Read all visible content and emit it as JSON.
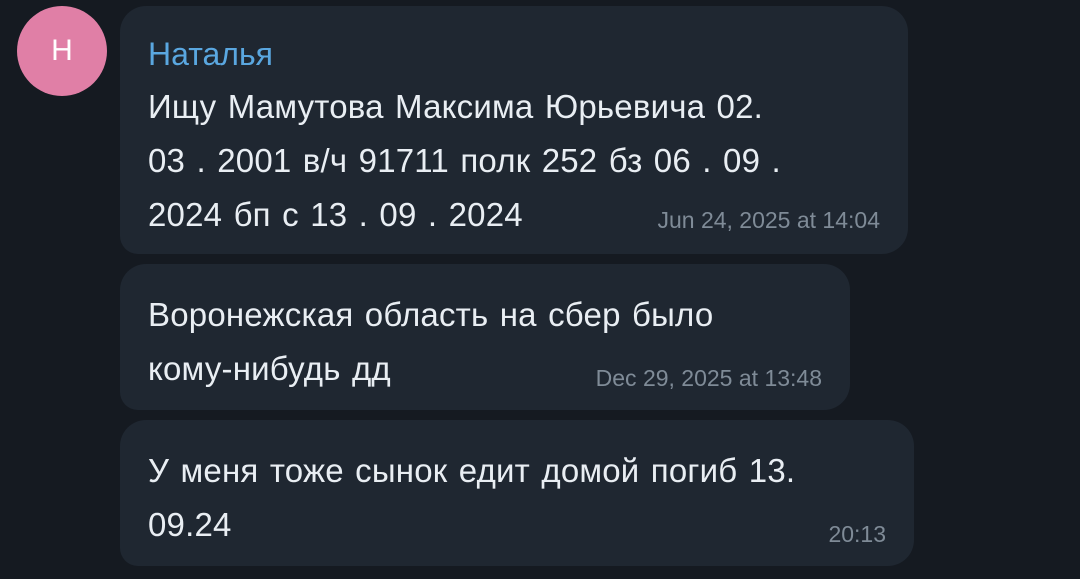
{
  "avatar": {
    "initial": "Н",
    "color": "#e07fa6"
  },
  "sender": {
    "name": "Наталья",
    "color": "#5aa7e0"
  },
  "messages": [
    {
      "lines": [
        "Ищу  Мамутова  Максима  Юрьевича  02.",
        "03 . 2001 в/ч 91711 полк 252  бз  06 . 09 .",
        "2024 бп с 13 . 09 . 2024"
      ],
      "time": "Jun 24, 2025 at 14:04"
    },
    {
      "lines": [
        "Воронежская область   на сбер  было",
        "кому-нибудь дд"
      ],
      "time": "Dec 29, 2025 at 13:48"
    },
    {
      "lines": [
        "У меня тоже сынок едит домой  погиб 13.",
        "09.24"
      ],
      "time": "20:13"
    }
  ],
  "colors": {
    "background": "#151a21",
    "bubble": "#1f2731",
    "text": "#e9eef3",
    "timestamp": "#7f8b97"
  }
}
